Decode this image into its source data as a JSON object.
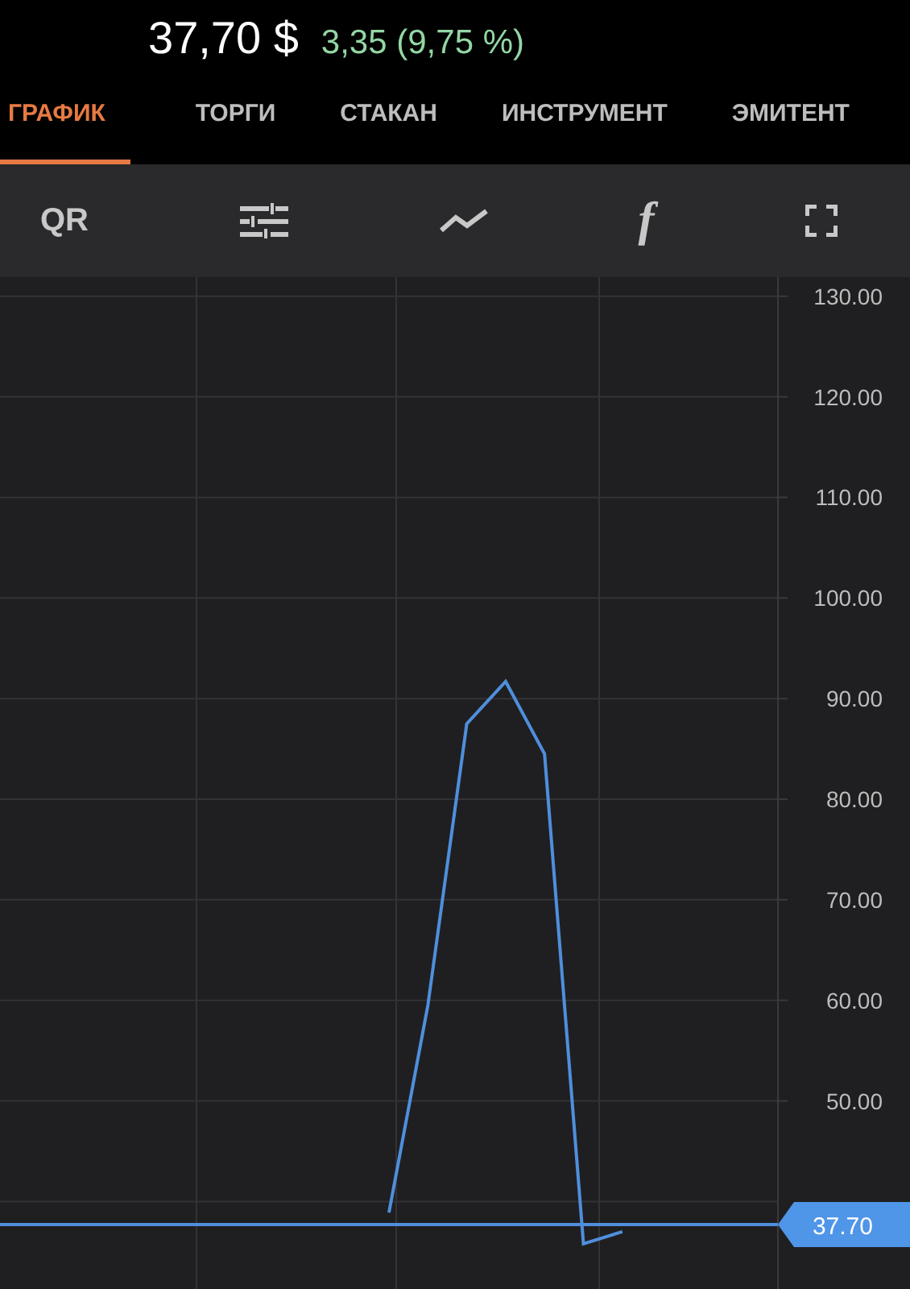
{
  "header": {
    "price": "37,70 $",
    "change": "3,35 (9,75 %)"
  },
  "tabs": [
    {
      "label": "ГРАФИК",
      "selected": true
    },
    {
      "label": "ТОРГИ",
      "selected": false
    },
    {
      "label": "СТАКАН",
      "selected": false
    },
    {
      "label": "ИНСТРУМЕНТ",
      "selected": false
    },
    {
      "label": "ЭМИТЕНТ",
      "selected": false
    }
  ],
  "toolbar": [
    {
      "kind": "text",
      "label": "QR"
    },
    {
      "kind": "sliders"
    },
    {
      "kind": "line"
    },
    {
      "kind": "formula",
      "label": "f"
    },
    {
      "kind": "fullscreen"
    }
  ],
  "chart": {
    "chart_data": {
      "type": "line",
      "grid": true,
      "ylim": [
        31.3,
        131.9
      ],
      "yticks": [
        {
          "value": 50,
          "label": "50.00"
        },
        {
          "value": 60,
          "label": "60.00"
        },
        {
          "value": 70,
          "label": "70.00"
        },
        {
          "value": 80,
          "label": "80.00"
        },
        {
          "value": 90,
          "label": "90.00"
        },
        {
          "value": 100,
          "label": "100.00"
        },
        {
          "value": 110,
          "label": "110.00"
        },
        {
          "value": 120,
          "label": "120.00"
        },
        {
          "value": 130,
          "label": "130.00"
        }
      ],
      "series": [
        {
          "color": "#4f8fdc",
          "values": [
            null,
            null,
            null,
            null,
            null,
            null,
            null,
            null,
            null,
            null,
            38.9,
            59.5,
            87.5,
            91.7,
            84.5,
            35.8,
            37.0,
            null,
            null,
            null,
            null
          ]
        },
        {
          "color": "#4f8fdc",
          "values": [
            37.7,
            37.7,
            37.7,
            37.7,
            37.7,
            37.7,
            37.7,
            37.7,
            37.7,
            37.7,
            37.7,
            37.7,
            37.7,
            37.7,
            37.7,
            37.7,
            37.7,
            37.7,
            37.7,
            37.7,
            37.7
          ]
        }
      ],
      "annotations": [
        "37.70"
      ]
    }
  }
}
